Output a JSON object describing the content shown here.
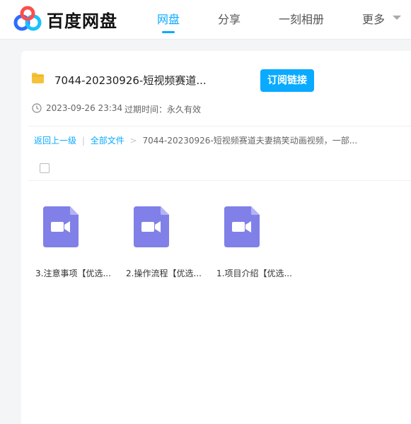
{
  "brand": {
    "name": "百度网盘",
    "accent": "#09aaff"
  },
  "nav": {
    "items": [
      {
        "label": "网盘",
        "active": true
      },
      {
        "label": "分享",
        "active": false
      },
      {
        "label": "一刻相册",
        "active": false
      },
      {
        "label": "更多",
        "active": false
      }
    ]
  },
  "share": {
    "title": "7044-20230926-短视频赛道...",
    "subscribe_label": "订阅链接",
    "date": "2023-09-26 23:34",
    "expire": "过期时间：永久有效"
  },
  "breadcrumb": {
    "back": "返回上一级",
    "sep": "|",
    "all_files": "全部文件",
    "arrow": ">",
    "current": "7044-20230926-短视频赛道夫妻搞笑动画视频，一部..."
  },
  "files": [
    {
      "name": "3.注意事项【优选...",
      "icon": "video-file-icon"
    },
    {
      "name": "2.操作流程【优选...",
      "icon": "video-file-icon"
    },
    {
      "name": "1.项目介绍【优选...",
      "icon": "video-file-icon"
    }
  ],
  "colors": {
    "video_icon": "#8080e8",
    "folder": "#f5c33b"
  }
}
